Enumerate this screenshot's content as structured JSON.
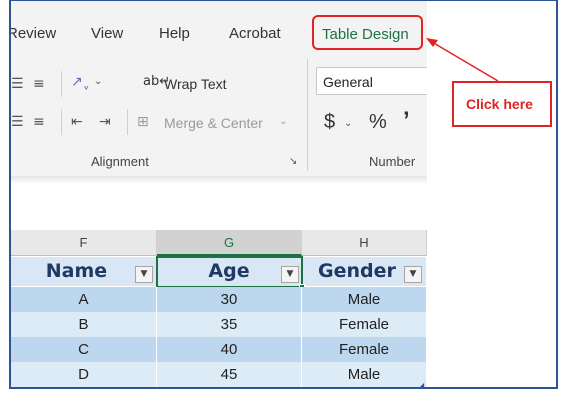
{
  "ribbon_tabs": {
    "review": "Review",
    "view": "View",
    "help": "Help",
    "acrobat": "Acrobat",
    "table_design": "Table Design"
  },
  "alignment_group": {
    "wrap_text": "Wrap Text",
    "merge_center": "Merge & Center",
    "label": "Alignment"
  },
  "number_group": {
    "format_value": "General",
    "currency_symbol": "$",
    "percent_symbol": "%",
    "comma_symbol": "’",
    "label": "Number"
  },
  "columns": [
    "F",
    "G",
    "H"
  ],
  "table": {
    "headers": [
      "Name",
      "Age",
      "Gender"
    ],
    "rows": [
      [
        "A",
        "30",
        "Male"
      ],
      [
        "B",
        "35",
        "Female"
      ],
      [
        "C",
        "40",
        "Female"
      ],
      [
        "D",
        "45",
        "Male"
      ]
    ]
  },
  "annotation": {
    "callout_text": "Click here",
    "color": "#e02424"
  },
  "colors": {
    "accent_green": "#1e7145",
    "header_text": "#1f3864",
    "band_dark": "#bdd7ee",
    "band_light": "#ddebf7",
    "frame": "#2f5496"
  }
}
